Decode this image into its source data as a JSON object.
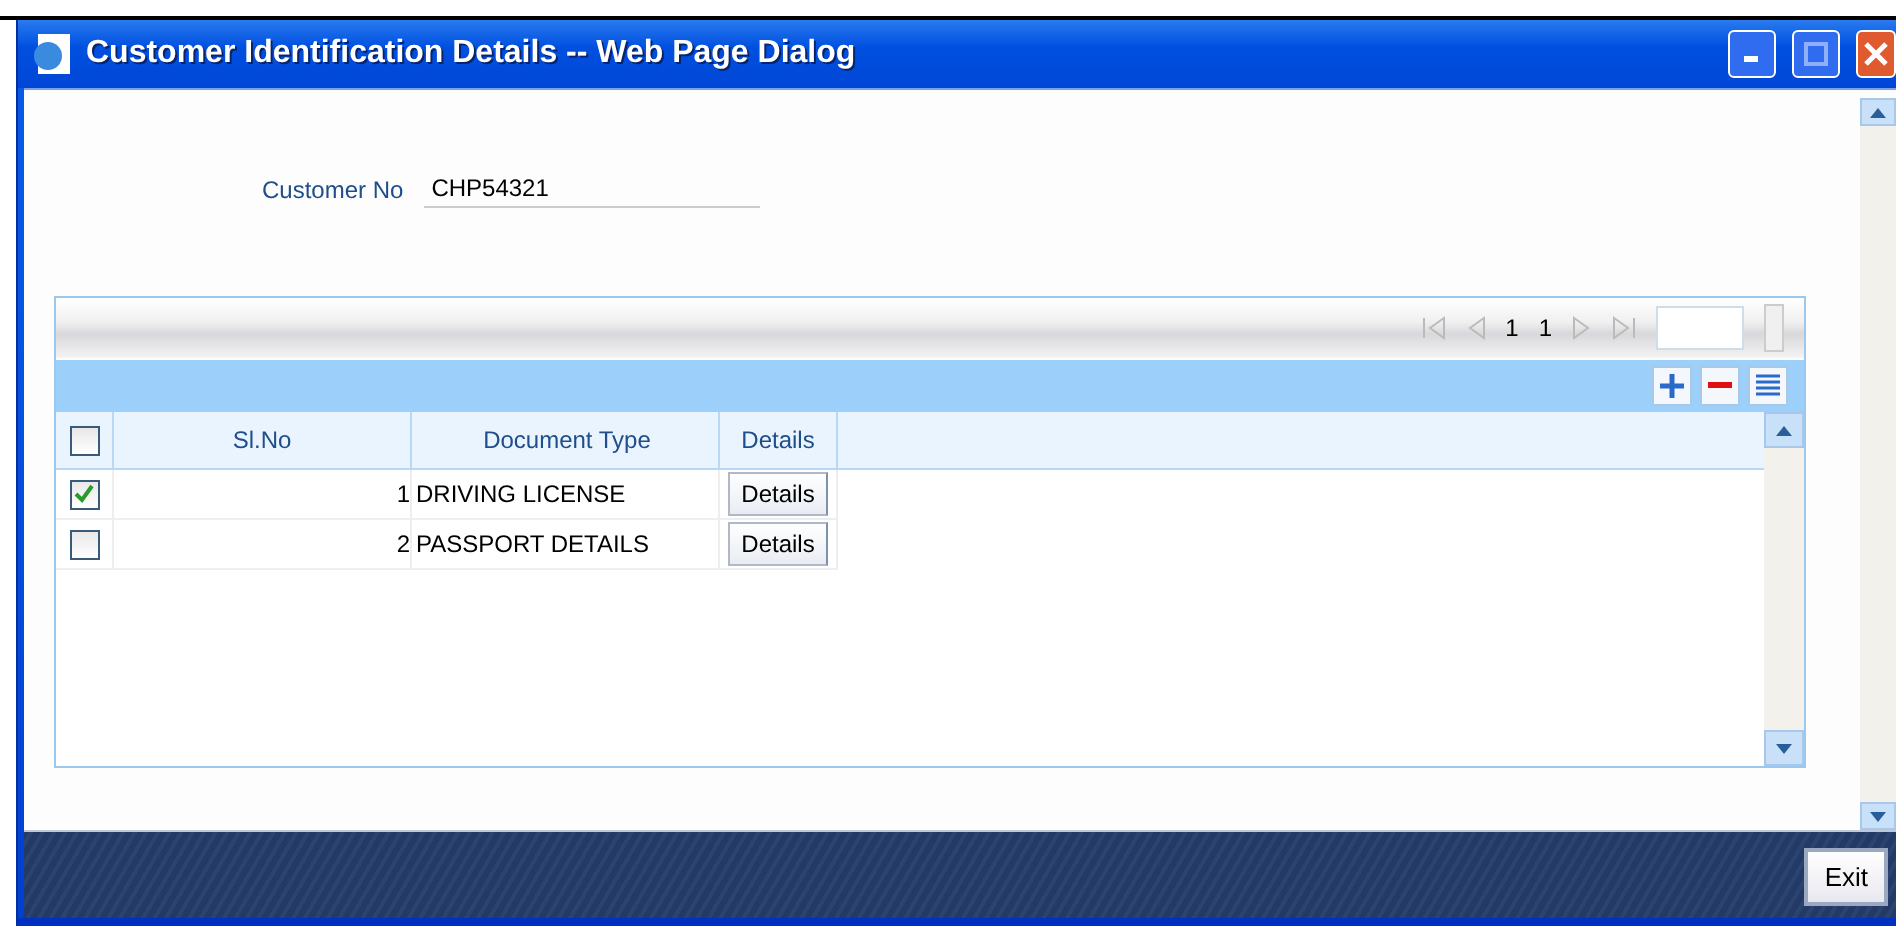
{
  "window": {
    "title": "Customer Identification Details -- Web Page Dialog"
  },
  "customer": {
    "label": "Customer No",
    "value": "CHP54321"
  },
  "pager": {
    "current": "1",
    "total": "1"
  },
  "grid": {
    "select_all": {
      "checked": false
    },
    "columns": [
      "Sl.No",
      "Document Type",
      "Details"
    ],
    "rows": [
      {
        "checked": true,
        "sl_no": "1",
        "document_type": "DRIVING LICENSE",
        "details": "Details"
      },
      {
        "checked": false,
        "sl_no": "2",
        "document_type": "PASSPORT DETAILS",
        "details": "Details"
      }
    ]
  },
  "footer": {
    "exit": "Exit"
  }
}
